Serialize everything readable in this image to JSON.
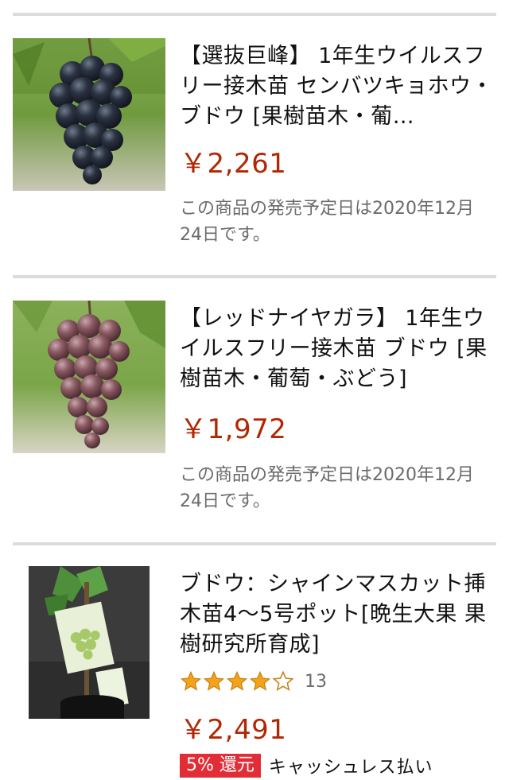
{
  "results": [
    {
      "title": "【選抜巨峰】 1年生ウイルスフリー接木苗 センバツキョホウ・ブドウ [果樹苗木・葡…",
      "price": "￥2,261",
      "release_note": "この商品の発売予定日は2020年12月24日です。"
    },
    {
      "title": "【レッドナイヤガラ】 1年生ウイルスフリー接木苗 ブドウ [果樹苗木・葡萄・ぶどう]",
      "price": "￥1,972",
      "release_note": "この商品の発売予定日は2020年12月24日です。"
    },
    {
      "title": "ブドウ：シャインマスカット挿木苗4〜5号ポット[晩生大果 果樹研究所育成]",
      "rating": 4,
      "review_count": "13",
      "price": "￥2,491",
      "cashback_badge": "5% 還元",
      "cashback_label": "キャッシュレス払い"
    }
  ],
  "colors": {
    "price": "#b12704",
    "star": "#f2a31b",
    "cashback_badge": "#e22d36"
  }
}
